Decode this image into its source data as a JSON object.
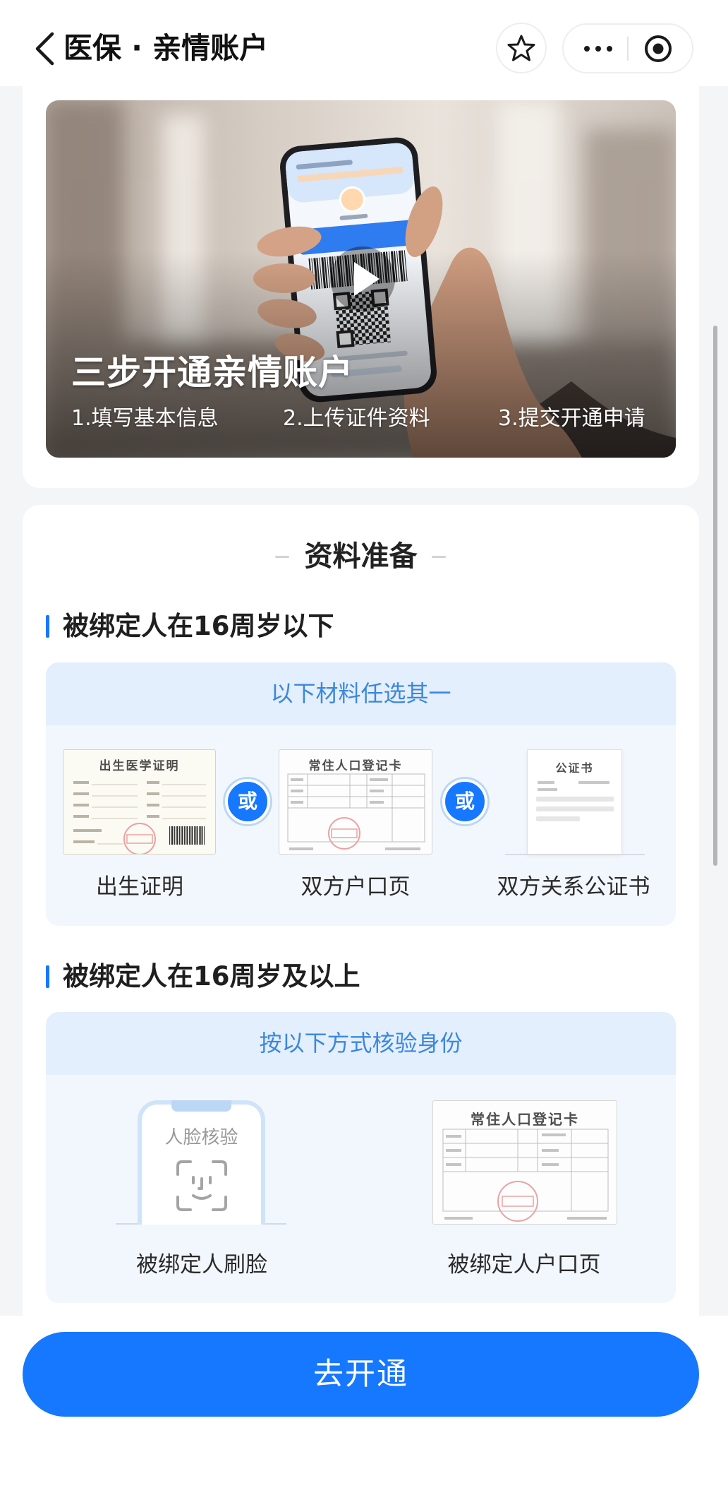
{
  "header": {
    "title": "医保 · 亲情账户",
    "back_icon": "chevron-left-icon",
    "star_icon": "star-icon",
    "more_icon": "more-dots-icon",
    "close_icon": "target-circle-icon"
  },
  "video": {
    "title": "三步开通亲情账户",
    "steps": [
      "1.填写基本信息",
      "2.上传证件资料",
      "3.提交开通申请"
    ],
    "play_icon": "play-icon"
  },
  "prep": {
    "title": "资料准备",
    "under16": {
      "heading": "被绑定人在16周岁以下",
      "box_title": "以下材料任选其一",
      "or_label": "或",
      "items": [
        {
          "doc_title": "出生医学证明",
          "label": "出生证明"
        },
        {
          "doc_title": "常住人口登记卡",
          "label": "双方户口页"
        },
        {
          "doc_title": "公证书",
          "label": "双方关系公证书"
        }
      ]
    },
    "over16": {
      "heading": "被绑定人在16周岁及以上",
      "box_title": "按以下方式核验身份",
      "items": [
        {
          "doc_title": "人脸核验",
          "label": "被绑定人刷脸",
          "icon": "face-scan-icon"
        },
        {
          "doc_title": "常住人口登记卡",
          "label": "被绑定人户口页"
        }
      ]
    }
  },
  "cta": {
    "label": "去开通"
  },
  "colors": {
    "primary": "#1677ff",
    "accent_text": "#3c87de",
    "box_bg": "#f2f7fd",
    "box_header_bg": "#e3effc",
    "page_bg": "#f4f5f7",
    "stamp_red": "#e9a3a3"
  }
}
